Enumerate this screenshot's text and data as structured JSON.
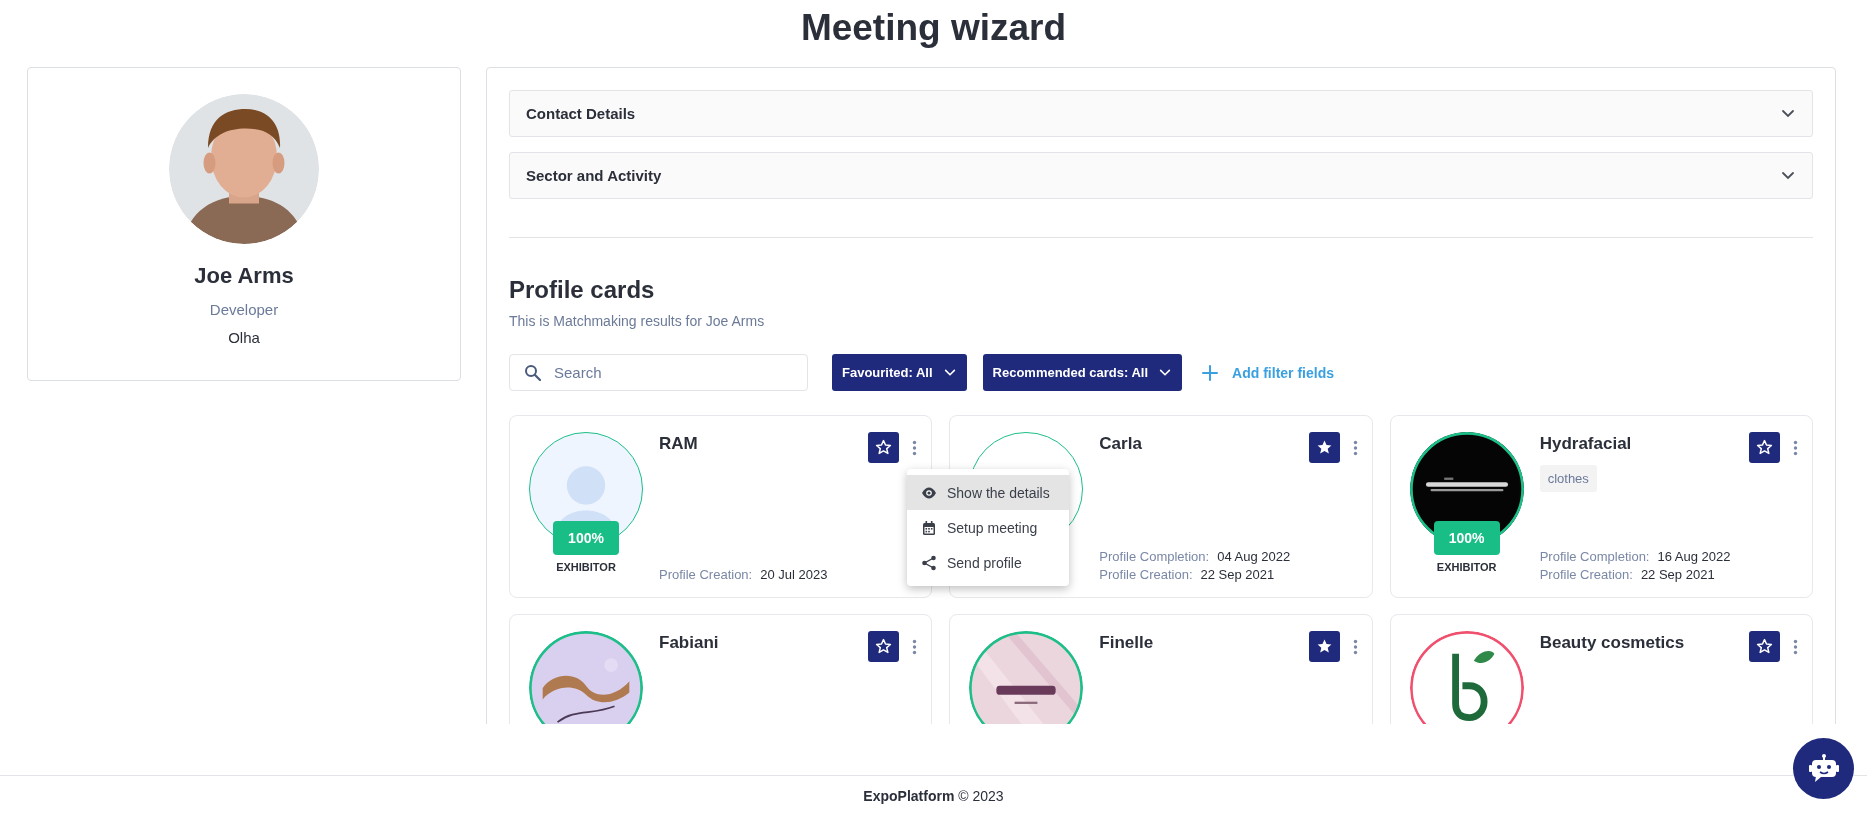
{
  "page": {
    "title": "Meeting wizard"
  },
  "user_card": {
    "avatar": {
      "kind": "picture"
    },
    "name": "Joe Arms",
    "role": "Developer",
    "company": "Olha"
  },
  "accordions": [
    {
      "label": "Contact Details",
      "expanded": false
    },
    {
      "label": "Sector and Activity",
      "expanded": false
    }
  ],
  "results": {
    "title": "Profile cards",
    "subtitle": "This is Matchmaking results for Joe Arms"
  },
  "filters": {
    "search": {
      "placeholder": "Search"
    },
    "dropdowns": [
      {
        "label": "Favourited: All"
      },
      {
        "label": "Recommended cards: All"
      }
    ],
    "add_filter": "Add filter fields"
  },
  "cards": [
    {
      "name": "RAM",
      "avatar": {
        "kind": "placeholder"
      },
      "color": "#1dbf88",
      "favourited": false,
      "completion": "100%",
      "role": "EXHIBITOR",
      "details": [
        {
          "label": "Profile Creation:",
          "value": "20 Jul 2023"
        }
      ],
      "menu": {
        "items": [
          {
            "kind": "view",
            "label": "Show the details",
            "highlighted": true
          },
          {
            "kind": "meeting",
            "label": "Setup meeting",
            "highlighted": false
          },
          {
            "kind": "share",
            "label": "Send profile",
            "highlighted": false
          }
        ]
      }
    },
    {
      "name": "Carla",
      "avatar": {
        "kind": "blank"
      },
      "color": "#1dbf88",
      "favourited": true,
      "details": [
        {
          "label": "Profile Completion:",
          "value": "04 Aug 2022"
        },
        {
          "label": "Profile Creation:",
          "value": "22 Sep 2021"
        }
      ]
    },
    {
      "name": "Hydrafacial",
      "avatar": {
        "kind": "picture"
      },
      "color": "#1dbf88",
      "favourited": false,
      "completion": "100%",
      "role": "EXHIBITOR",
      "tags": [
        "clothes"
      ],
      "details": [
        {
          "label": "Profile Completion:",
          "value": "16 Aug 2022"
        },
        {
          "label": "Profile Creation:",
          "value": "22 Sep 2021"
        }
      ]
    },
    {
      "name": "Fabiani",
      "avatar": {
        "kind": "picture"
      },
      "color": "#1dbf88",
      "favourited": false
    },
    {
      "name": "Finelle",
      "avatar": {
        "kind": "picture"
      },
      "color": "#1dbf88",
      "favourited": true
    },
    {
      "name": "Beauty cosmetics",
      "avatar": {
        "kind": "picture"
      },
      "color": "#f0506e",
      "favourited": false
    }
  ],
  "footer": {
    "text": "**ExpoPlatform** © 2023"
  }
}
